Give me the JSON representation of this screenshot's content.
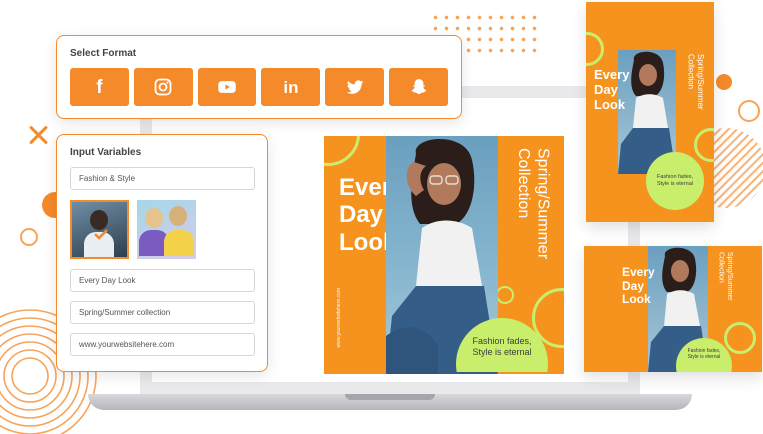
{
  "format_panel": {
    "title": "Select Format",
    "buttons": [
      {
        "name": "facebook",
        "glyph": "f"
      },
      {
        "name": "instagram"
      },
      {
        "name": "youtube"
      },
      {
        "name": "linkedin",
        "glyph": "in"
      },
      {
        "name": "twitter"
      },
      {
        "name": "snapchat"
      }
    ]
  },
  "variables_panel": {
    "title": "Input Variables",
    "category_value": "Fashion & Style",
    "headline_value": "Every Day Look",
    "subtitle_value": "Spring/Summer collection",
    "website_value": "www.yourwebsitehere.com"
  },
  "design": {
    "headline_line1": "Every",
    "headline_line2": "Day",
    "headline_line3": "Look",
    "vertical_title_line1": "Spring/Summer",
    "vertical_title_line2": "Collection",
    "tagline_line1": "Fashion fades,",
    "tagline_line2": "Style is eternal",
    "website": "www.yourwebsitehere.com"
  },
  "colors": {
    "brand_orange": "#f58a2a",
    "canvas_orange": "#f6931f",
    "accent_lime": "#c9ee6b"
  }
}
